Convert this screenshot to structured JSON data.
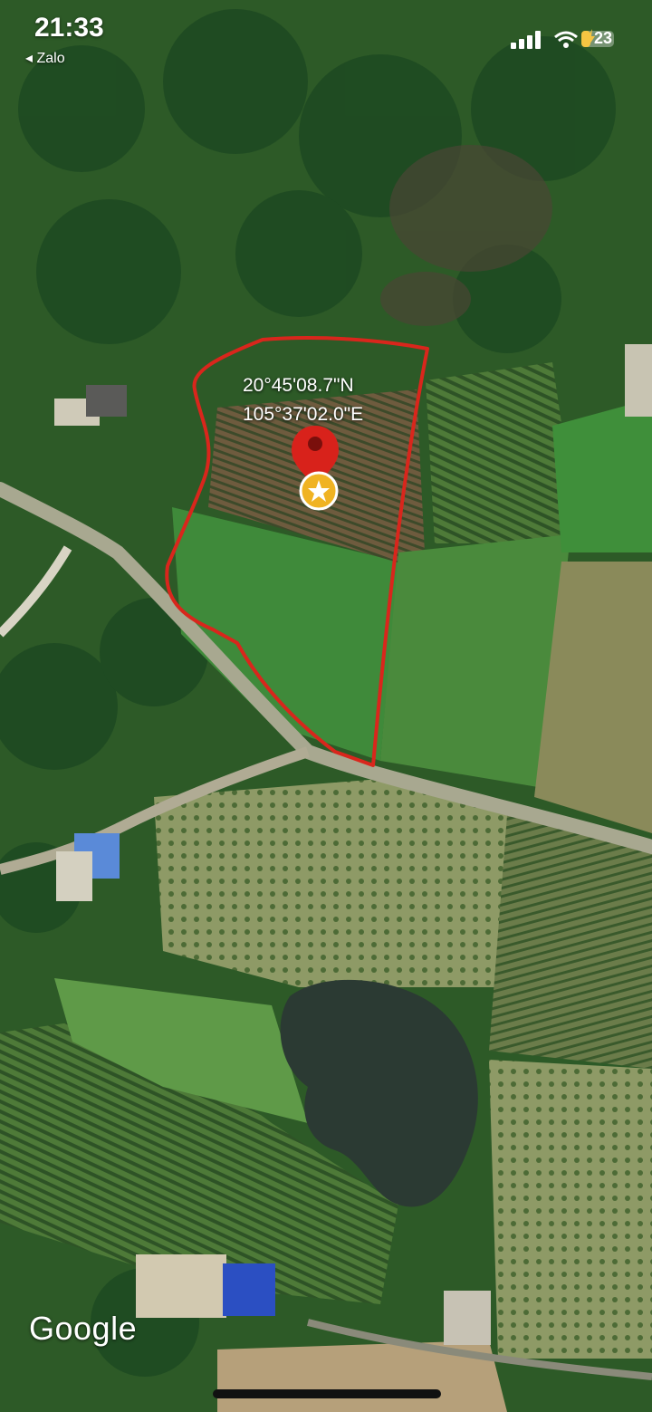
{
  "status_bar": {
    "time": "21:33",
    "back_app": "◂ Zalo",
    "battery_level": "23",
    "battery_color": "#f5c542"
  },
  "location": {
    "latitude": "20°45'08.7\"N",
    "longitude": "105°37'02.0\"E"
  },
  "attribution": "Google",
  "icons": [
    "cellular-signal-icon",
    "wifi-icon",
    "battery-icon",
    "map-pin-icon",
    "star-icon"
  ],
  "colors": {
    "boundary": "#d9261c",
    "pin": "#d8221b",
    "star_badge": "#f0b323"
  }
}
